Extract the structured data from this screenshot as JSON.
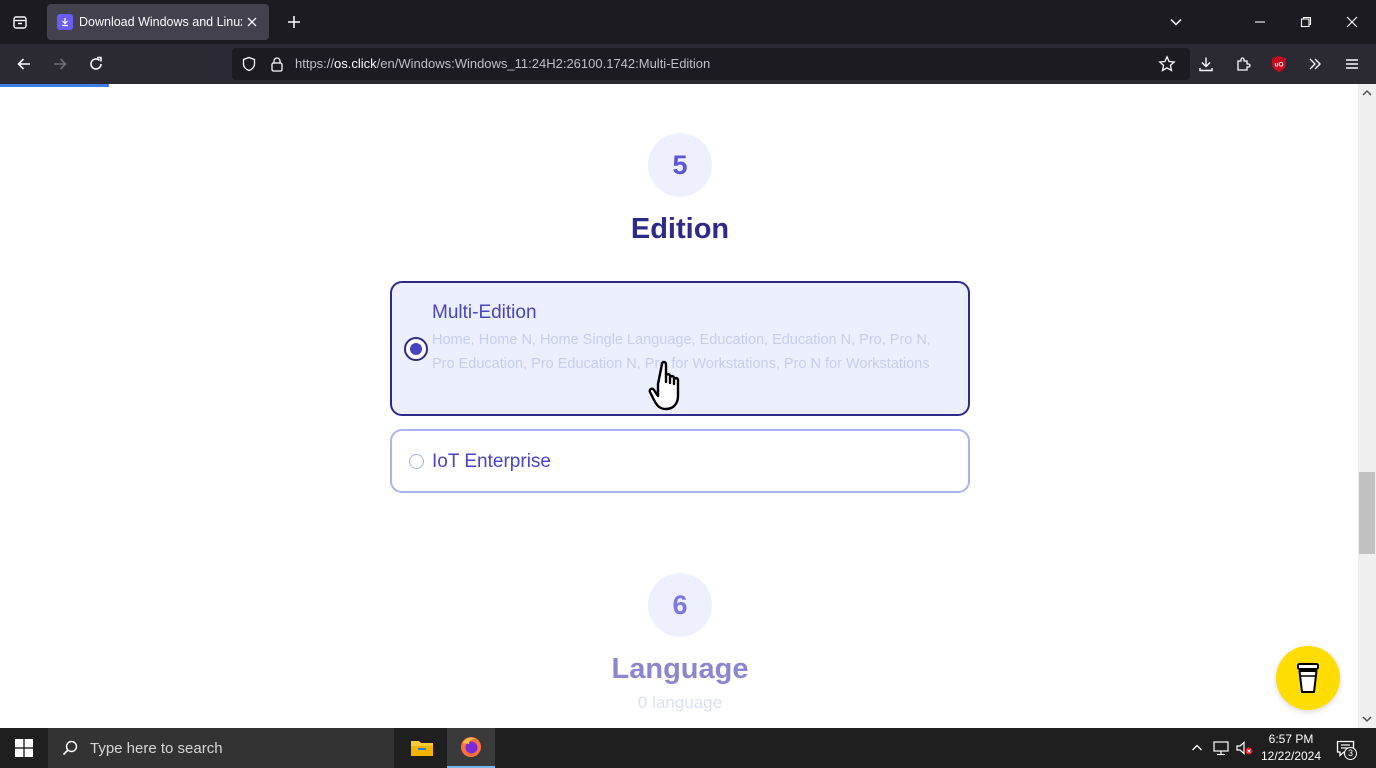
{
  "browser": {
    "tab_title": "Download Windows and Linux",
    "url_prefix": "https://",
    "url_host": "os.click",
    "url_path": "/en/Windows:Windows_11:24H2:26100.1742:Multi-Edition"
  },
  "steps": [
    {
      "number": "5",
      "title": "Edition"
    },
    {
      "number": "6",
      "title": "Language",
      "subtitle": "0 language"
    }
  ],
  "editions": [
    {
      "name": "Multi-Edition",
      "description": "Home, Home N, Home Single Language, Education, Education N, Pro, Pro N, Pro Education, Pro Education N, Pro for Workstations, Pro N for Workstations",
      "selected": true
    },
    {
      "name": "IoT Enterprise",
      "selected": false
    }
  ],
  "taskbar": {
    "search_placeholder": "Type here to search",
    "time": "6:57 PM",
    "date": "12/22/2024",
    "notification_count": "3"
  },
  "colors": {
    "accent": "#2e2a8a",
    "accent_light": "#4944c4",
    "step_bg": "#eef0fd",
    "coffee": "#ffdd00"
  }
}
